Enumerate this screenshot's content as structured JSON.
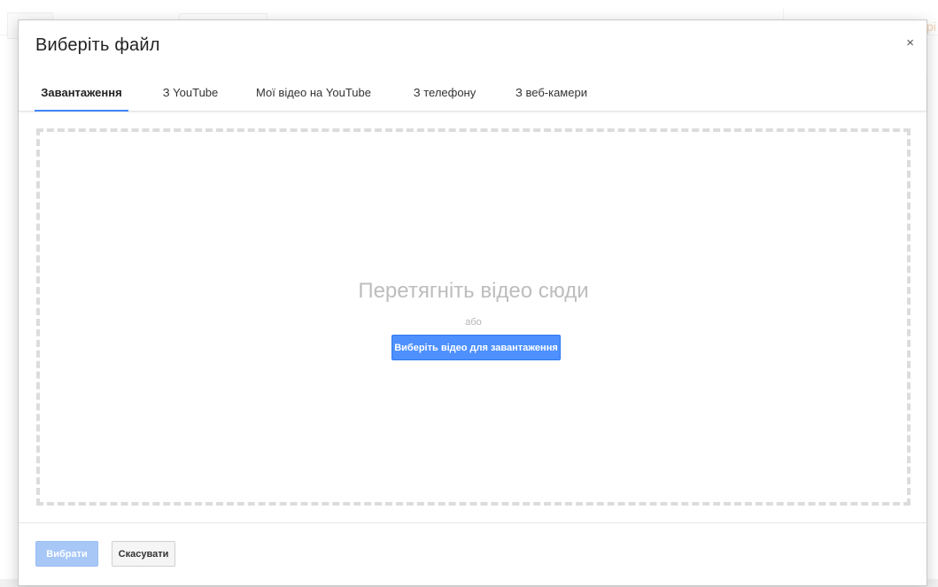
{
  "background": {
    "partial_text": "рі"
  },
  "dialog": {
    "title": "Виберіть файл",
    "close_symbol": "×",
    "tabs": [
      {
        "label": "Завантаження",
        "active": true
      },
      {
        "label": "З YouTube",
        "active": false
      },
      {
        "label": "Мої відео на YouTube",
        "active": false
      },
      {
        "label": "З телефону",
        "active": false
      },
      {
        "label": "З веб-камери",
        "active": false
      }
    ],
    "drop_zone": {
      "title": "Перетягніть відео сюди",
      "or_text": "або",
      "upload_button_label": "Виберіть відео для завантаження"
    },
    "footer": {
      "select_label": "Вибрати",
      "cancel_label": "Скасувати"
    }
  },
  "colors": {
    "accent": "#4285f4",
    "primary_button": "#4d90fe",
    "disabled_button": "#a7c7f7",
    "dropzone_border": "#dcdcdc"
  }
}
